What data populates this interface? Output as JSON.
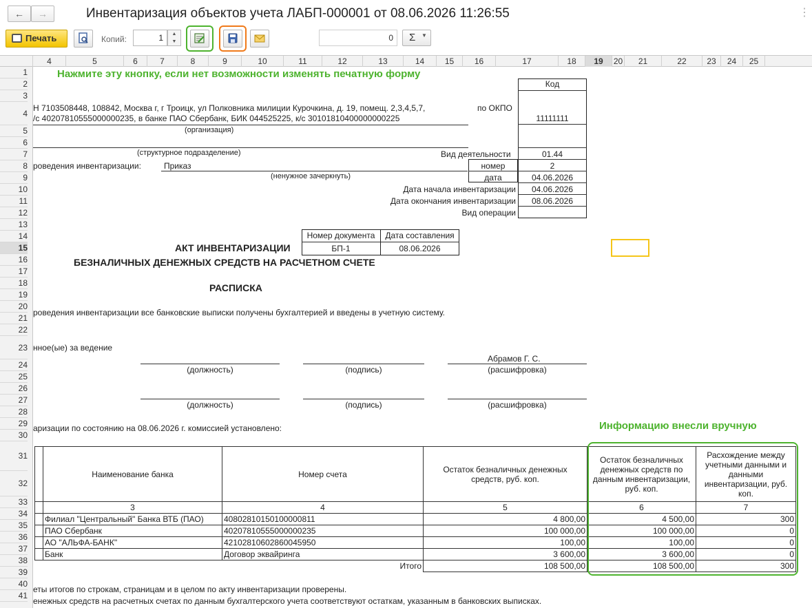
{
  "window": {
    "title": "Инвентаризация объектов учета ЛАБП-000001 от 08.06.2026 11:26:55",
    "back": "←",
    "forward": "→",
    "more": "⋮"
  },
  "toolbar": {
    "print_label": "Печать",
    "copies_label": "Копий:",
    "copies_value": "1",
    "sum_value": "0",
    "sum_symbol": "Σ",
    "highlight_colors": {
      "edit": "#4db32e",
      "save": "#f07a1a"
    }
  },
  "ruler": {
    "columns": [
      "4",
      "5",
      "6",
      "7",
      "8",
      "9",
      "10",
      "11",
      "12",
      "13",
      "14",
      "15",
      "16",
      "17",
      "18",
      "19",
      "20",
      "21",
      "22",
      "23",
      "24",
      "25"
    ],
    "active": "19"
  },
  "rows": [
    "1",
    "2",
    "3",
    "4",
    "5",
    "6",
    "7",
    "8",
    "9",
    "10",
    "11",
    "12",
    "13",
    "14",
    "15",
    "16",
    "17",
    "18",
    "19",
    "20",
    "21",
    "22",
    "23",
    "24",
    "25",
    "26",
    "27",
    "28",
    "29",
    "30",
    "31",
    "32",
    "33",
    "34",
    "35",
    "36",
    "37",
    "38",
    "39",
    "40",
    "41"
  ],
  "active_row": "15",
  "annotations": {
    "edit_hint": "Нажмите эту кнопку, если нет возможности изменять печатную форму",
    "manual_hint": "Информацию внесли вручную"
  },
  "form": {
    "kod_header": "Код",
    "org_line1": "Н 7103508448, 108842, Москва г, г Троицк, ул Полковника милиции Курочкина, д. 19, помещ. 2,3,4,5,7,",
    "org_line2": "/с 40207810555000000235, в банке ПАО Сбербанк, БИК 044525225, к/с 30101810400000000225",
    "okpo_label": "по ОКПО",
    "okpo_value": "11111111",
    "org_caption": "(организация)",
    "subdivision_caption": "(структурное подразделение)",
    "activity_label": "Вид деятельности",
    "activity_value": "01.44",
    "basis_label": "роведения инвентаризации:",
    "basis_value": "Приказ",
    "number_label": "номер",
    "number_value": "2",
    "cross_caption": "(ненужное зачеркнуть)",
    "date_label": "дата",
    "date_value": "04.06.2026",
    "start_label": "Дата начала инвентаризации",
    "start_value": "04.06.2026",
    "end_label": "Дата окончания инвентаризации",
    "end_value": "08.06.2026",
    "operation_label": "Вид операции",
    "doc_number_header": "Номер документа",
    "doc_date_header": "Дата составления",
    "doc_number": "БП-1",
    "doc_date": "08.06.2026",
    "act_title": "АКТ ИНВЕНТАРИЗАЦИИ",
    "act_subtitle": "БЕЗНАЛИЧНЫХ ДЕНЕЖНЫХ СРЕДСТВ НА РАСЧЕТНОМ СЧЕТЕ",
    "receipt_title": "РАСПИСКА",
    "receipt_text": "роведения инвентаризации все банковские выписки получены бухгалтерией и введены в учетную систему.",
    "responsible_label": "нное(ые) за ведение",
    "signer_name": "Абрамов Г. С.",
    "position_caption": "(должность)",
    "signature_caption": "(подпись)",
    "decode_caption": "(расшифровка)",
    "commission_text": "аризации по состоянию на 08.06.2026 г. комиссией установлено:",
    "footer_line1": "еты итогов по строкам, страницам и в целом по акту инвентаризации проверены.",
    "footer_line2": "енежных средств на расчетных счетах по данным бухгалтерского учета соответствуют остаткам, указанным в банковских выписках."
  },
  "table": {
    "headers": [
      "Наименование банка",
      "Номер счета",
      "Остаток безналичных денежных средств, руб. коп.",
      "Остаток безналичных денежных средств по данным инвентаризации, руб. коп.",
      "Расхождение между учетными данными и данными инвентаризации, руб. коп."
    ],
    "col_numbers": [
      "3",
      "4",
      "5",
      "6",
      "7"
    ],
    "rows": [
      [
        "Филиал \"Центральный\" Банка ВТБ (ПАО)",
        "40802810150100000811",
        "4 800,00",
        "4 500,00",
        "300"
      ],
      [
        "ПАО Сбербанк",
        "40207810555000000235",
        "100 000,00",
        "100 000,00",
        "0"
      ],
      [
        "АО \"АЛЬФА-БАНК\"",
        "42102810602860045950",
        "100,00",
        "100,00",
        "0"
      ],
      [
        "Банк",
        "Договор эквайринга",
        "3 600,00",
        "3 600,00",
        "0"
      ]
    ],
    "total_label": "Итого",
    "total": [
      "108 500,00",
      "108 500,00",
      "300"
    ]
  }
}
